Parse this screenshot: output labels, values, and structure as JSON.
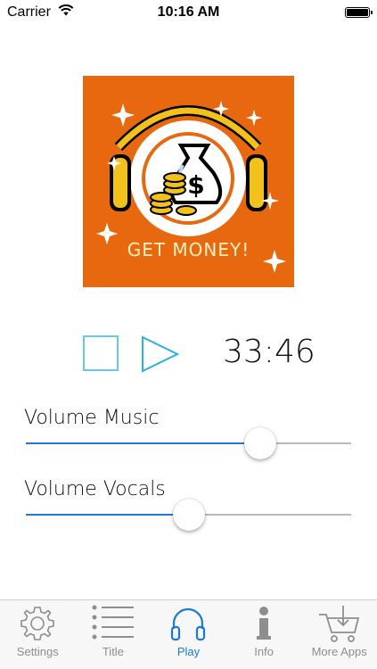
{
  "status_bar": {
    "carrier": "Carrier",
    "time": "10:16 AM"
  },
  "artwork": {
    "caption": "GET MONEY!",
    "background_color": "#e8680f"
  },
  "player": {
    "timer": "33:46"
  },
  "sliders": {
    "music": {
      "label": "Volume Music",
      "value_fraction": 0.72
    },
    "vocals": {
      "label": "Volume Vocals",
      "value_fraction": 0.5
    }
  },
  "tab_bar": {
    "tabs": [
      {
        "label": "Settings",
        "icon": "gear-icon",
        "active": false
      },
      {
        "label": "Title",
        "icon": "list-icon",
        "active": false
      },
      {
        "label": "Play",
        "icon": "headphones-icon",
        "active": true
      },
      {
        "label": "Info",
        "icon": "info-icon",
        "active": false
      },
      {
        "label": "More Apps",
        "icon": "cart-download-icon",
        "active": false
      }
    ]
  },
  "colors": {
    "accent": "#1a7ad6",
    "control_outline": "#6cc6ec",
    "inactive": "#8e8e8e"
  }
}
